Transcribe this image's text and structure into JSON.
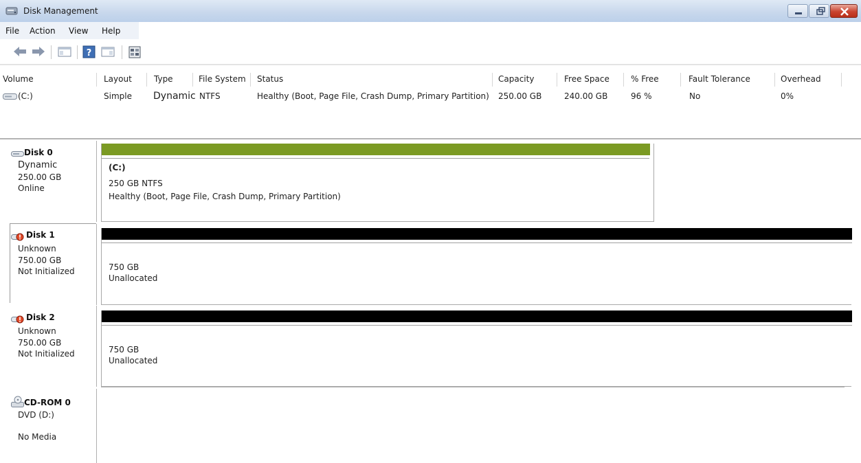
{
  "window": {
    "title": "Disk Management",
    "icon": "disk-management-icon"
  },
  "menu": [
    "File",
    "Action",
    "View",
    "Help"
  ],
  "toolbar": [
    "back-arrow-icon",
    "forward-arrow-icon",
    "show-hide-console-tree-icon",
    "help-icon",
    "show-hide-action-pane-icon",
    "properties-icon"
  ],
  "volume_list": {
    "columns": [
      "Volume",
      "Layout",
      "Type",
      "File System",
      "Status",
      "Capacity",
      "Free Space",
      "% Free",
      "Fault Tolerance",
      "Overhead"
    ],
    "rows": [
      {
        "volume": "(C:)",
        "layout": "Simple",
        "type": "Dynamic",
        "file_system": "NTFS",
        "status": "Healthy (Boot, Page File, Crash Dump, Primary Partition)",
        "capacity": "250.00 GB",
        "free_space": "240.00 GB",
        "pct_free": "96 %",
        "fault_tolerance": "No",
        "overhead": "0%"
      }
    ]
  },
  "disks": [
    {
      "name": "Disk 0",
      "type": "Dynamic",
      "size": "250.00 GB",
      "status": "Online",
      "partition": {
        "label": "(C:)",
        "size_fs": "250 GB NTFS",
        "status": "Healthy (Boot, Page File, Crash Dump, Primary Partition)",
        "bar_color": "#7b9a23"
      }
    },
    {
      "name": "Disk 1",
      "type": "Unknown",
      "size": "750.00 GB",
      "status": "Not Initialized",
      "partition": {
        "size": "750 GB",
        "state": "Unallocated",
        "bar_color": "#000000"
      }
    },
    {
      "name": "Disk 2",
      "type": "Unknown",
      "size": "750.00 GB",
      "status": "Not Initialized",
      "partition": {
        "size": "750 GB",
        "state": "Unallocated",
        "bar_color": "#000000"
      }
    },
    {
      "name": "CD-ROM 0",
      "type": "DVD (D:)",
      "status": "No Media"
    }
  ]
}
